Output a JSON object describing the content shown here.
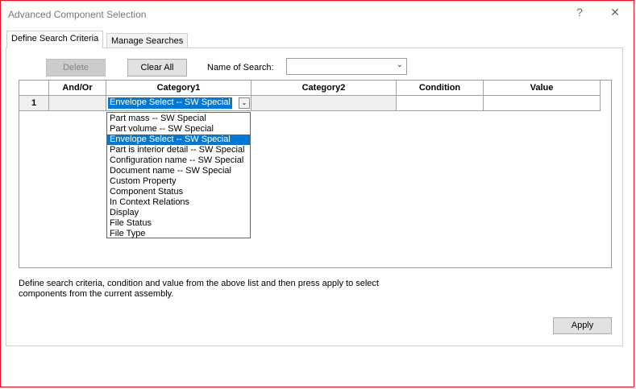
{
  "window": {
    "title": "Advanced Component Selection",
    "help_label": "?",
    "close_label": "✕"
  },
  "tabs": [
    {
      "label": "Define Search Criteria",
      "active": true
    },
    {
      "label": "Manage Searches",
      "active": false
    }
  ],
  "toolbar": {
    "delete_label": "Delete",
    "clear_all_label": "Clear All",
    "name_of_search_label": "Name of Search:",
    "name_of_search_value": ""
  },
  "grid": {
    "columns": [
      "",
      "And/Or",
      "Category1",
      "Category2",
      "Condition",
      "Value"
    ],
    "rows": [
      {
        "num": "1",
        "and_or": "",
        "category1": "Envelope Select -- SW Special",
        "category2": "",
        "condition": "",
        "value": ""
      }
    ]
  },
  "category1_dropdown": {
    "selected": "Envelope Select -- SW Special",
    "options": [
      "Part mass -- SW Special",
      "Part volume -- SW Special",
      "Envelope Select -- SW Special",
      "Part is interior detail -- SW Special",
      "Configuration name -- SW Special",
      "Document name -- SW Special",
      "Custom Property",
      "Component Status",
      "In Context Relations",
      "Display",
      "File Status",
      "File Type"
    ]
  },
  "description": "Define search criteria, condition and value from the above list and then press apply to select components from the current assembly.",
  "apply_label": "Apply",
  "colors": {
    "selection": "#0078d7",
    "window_border": "#e81123"
  }
}
